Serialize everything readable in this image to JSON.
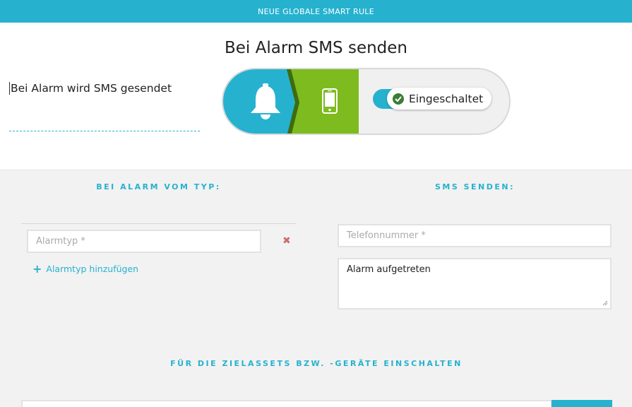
{
  "topbar": {
    "title": "NEUE GLOBALE SMART RULE"
  },
  "header": {
    "title": "Bei Alarm SMS senden",
    "description": "Bei Alarm wird SMS gesendet",
    "status": {
      "label": "Eingeschaltet",
      "enabled": true
    },
    "icons": {
      "trigger": "bell-icon",
      "action": "mobile-phone-icon"
    },
    "colors": {
      "accent": "#26b2cf",
      "action": "#7dbb1e",
      "status": "#3a7d3a"
    }
  },
  "left": {
    "heading": "BEI ALARM VOM TYP:",
    "alarm_type_placeholder": "Alarmtyp *",
    "remove_symbol": "✖",
    "add_label": "Alarmtyp hinzufügen"
  },
  "right": {
    "heading": "SMS SENDEN:",
    "phone_placeholder": "Telefonnummer *",
    "message_value": "Alarm aufgetreten"
  },
  "targets": {
    "heading": "FÜR DIE ZIELASSETS BZW. -GERÄTE EINSCHALTEN"
  }
}
